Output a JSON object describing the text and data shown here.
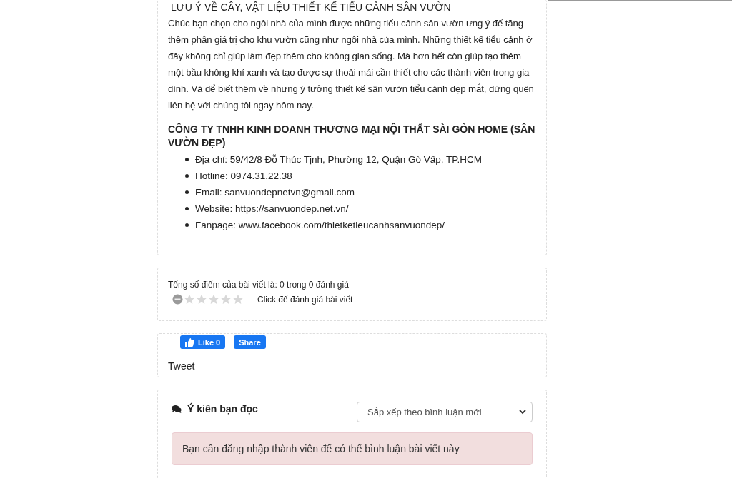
{
  "article": {
    "subtitle": "LƯU Ý VỀ CÂY, VẬT LIỆU THIẾT KẾ TIỂU CẢNH SÂN VƯỜN",
    "paragraph": "Chúc bạn chọn cho ngôi nhà của mình được những tiểu cảnh sân vườn ưng ý để tăng thêm phần giá trị cho khu vườn cũng như ngôi nhà của mình. Những thiết kế tiểu cảnh ở đây không chỉ giúp làm đẹp thêm cho không gian sống. Mà hơn hết còn giúp tạo thêm một bầu không khí xanh và tạo được sự thoải mái cần thiết cho các thành viên trong gia đình. Và để biết thêm về những ý tưởng thiết kế sân vườn tiểu cảnh đẹp mắt, đừng quên liên hệ với chúng tôi ngay hôm nay.",
    "company": "CÔNG TY TNHH KINH DOANH THƯƠNG MẠI NỘI THẤT SÀI GÒN HOME (SÂN VƯỜN ĐẸP)",
    "contacts": [
      "Địa chỉ: 59/42/8 Đỗ Thúc Tịnh, Phường 12, Quận Gò Vấp, TP.HCM",
      "Hotline: 0974.31.22.38",
      "Email: sanvuondepnetvn@gmail.com",
      "Website: https://sanvuondep.net.vn/",
      "Fanpage: www.facebook.com/thietketieucanhsanvuondep/"
    ]
  },
  "rating": {
    "summary": "Tổng số điểm của bài viết là: 0 trong 0 đánh giá",
    "stars": 0,
    "prompt": "Click để đánh giá bài viết"
  },
  "social": {
    "like": "Like 0",
    "share": "Share",
    "tweet": "Tweet"
  },
  "comments": {
    "title": "Ý kiến bạn đọc",
    "sort": "Sắp xếp theo bình luận mới",
    "notice": "Bạn cần đăng nhập thành viên để có thể bình luận bài viết này"
  }
}
